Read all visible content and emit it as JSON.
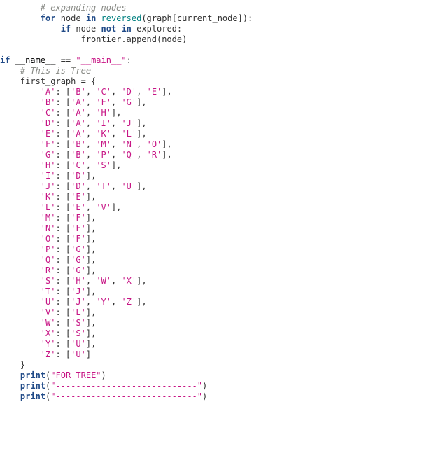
{
  "code": {
    "l1_indent": "        ",
    "l1_comment": "# expanding nodes",
    "l2_indent": "        ",
    "l2_kw_for": "for",
    "l2_var": " node ",
    "l2_kw_in": "in",
    "l2_sp": " ",
    "l2_builtin": "reversed",
    "l2_rest": "(graph[current_node]):",
    "l3_indent": "            ",
    "l3_kw_if": "if",
    "l3_mid": " node ",
    "l3_kw_not": "not",
    "l3_sp": " ",
    "l3_kw_in": "in",
    "l3_rest": " explored:",
    "l4_indent": "                ",
    "l4_rest": "frontier.append(node)",
    "l5_kw_if": "if",
    "l5_sp": " ",
    "l5_name": "__name__",
    "l5_eq": " == ",
    "l5_str": "\"__main__\"",
    "l5_colon": ":",
    "l6_indent": "    ",
    "l6_comment": "# This is Tree",
    "l7_indent": "    ",
    "l7_text": "first_graph = {",
    "graph_indent": "        ",
    "gA_k": "'A'",
    "gA_c": ": [",
    "gA_v1": "'B'",
    "gA_s1": ", ",
    "gA_v2": "'C'",
    "gA_s2": ", ",
    "gA_v3": "'D'",
    "gA_s3": ", ",
    "gA_v4": "'E'",
    "gA_end": "],",
    "gB_k": "'B'",
    "gB_c": ": [",
    "gB_v1": "'A'",
    "gB_s1": ", ",
    "gB_v2": "'F'",
    "gB_s2": ", ",
    "gB_v3": "'G'",
    "gB_end": "],",
    "gC_k": "'C'",
    "gC_c": ": [",
    "gC_v1": "'A'",
    "gC_s1": ", ",
    "gC_v2": "'H'",
    "gC_end": "],",
    "gD_k": "'D'",
    "gD_c": ": [",
    "gD_v1": "'A'",
    "gD_s1": ", ",
    "gD_v2": "'I'",
    "gD_s2": ", ",
    "gD_v3": "'J'",
    "gD_end": "],",
    "gE_k": "'E'",
    "gE_c": ": [",
    "gE_v1": "'A'",
    "gE_s1": ", ",
    "gE_v2": "'K'",
    "gE_s2": ", ",
    "gE_v3": "'L'",
    "gE_end": "],",
    "gF_k": "'F'",
    "gF_c": ": [",
    "gF_v1": "'B'",
    "gF_s1": ", ",
    "gF_v2": "'M'",
    "gF_s2": ", ",
    "gF_v3": "'N'",
    "gF_s3": ", ",
    "gF_v4": "'O'",
    "gF_end": "],",
    "gG_k": "'G'",
    "gG_c": ": [",
    "gG_v1": "'B'",
    "gG_s1": ", ",
    "gG_v2": "'P'",
    "gG_s2": ", ",
    "gG_v3": "'Q'",
    "gG_s3": ", ",
    "gG_v4": "'R'",
    "gG_end": "],",
    "gH_k": "'H'",
    "gH_c": ": [",
    "gH_v1": "'C'",
    "gH_s1": ", ",
    "gH_v2": "'S'",
    "gH_end": "],",
    "gI_k": "'I'",
    "gI_c": ": [",
    "gI_v1": "'D'",
    "gI_end": "],",
    "gJ_k": "'J'",
    "gJ_c": ": [",
    "gJ_v1": "'D'",
    "gJ_s1": ", ",
    "gJ_v2": "'T'",
    "gJ_s2": ", ",
    "gJ_v3": "'U'",
    "gJ_end": "],",
    "gK_k": "'K'",
    "gK_c": ": [",
    "gK_v1": "'E'",
    "gK_end": "],",
    "gL_k": "'L'",
    "gL_c": ": [",
    "gL_v1": "'E'",
    "gL_s1": ", ",
    "gL_v2": "'V'",
    "gL_end": "],",
    "gM_k": "'M'",
    "gM_c": ": [",
    "gM_v1": "'F'",
    "gM_end": "],",
    "gN_k": "'N'",
    "gN_c": ": [",
    "gN_v1": "'F'",
    "gN_end": "],",
    "gO_k": "'O'",
    "gO_c": ": [",
    "gO_v1": "'F'",
    "gO_end": "],",
    "gP_k": "'P'",
    "gP_c": ": [",
    "gP_v1": "'G'",
    "gP_end": "],",
    "gQ_k": "'Q'",
    "gQ_c": ": [",
    "gQ_v1": "'G'",
    "gQ_end": "],",
    "gR_k": "'R'",
    "gR_c": ": [",
    "gR_v1": "'G'",
    "gR_end": "],",
    "gS_k": "'S'",
    "gS_c": ": [",
    "gS_v1": "'H'",
    "gS_s1": ", ",
    "gS_v2": "'W'",
    "gS_s2": ", ",
    "gS_v3": "'X'",
    "gS_end": "],",
    "gT_k": "'T'",
    "gT_c": ": [",
    "gT_v1": "'J'",
    "gT_end": "],",
    "gU_k": "'U'",
    "gU_c": ": [",
    "gU_v1": "'J'",
    "gU_s1": ", ",
    "gU_v2": "'Y'",
    "gU_s2": ", ",
    "gU_v3": "'Z'",
    "gU_end": "],",
    "gV_k": "'V'",
    "gV_c": ": [",
    "gV_v1": "'L'",
    "gV_end": "],",
    "gW_k": "'W'",
    "gW_c": ": [",
    "gW_v1": "'S'",
    "gW_end": "],",
    "gX_k": "'X'",
    "gX_c": ": [",
    "gX_v1": "'S'",
    "gX_end": "],",
    "gY_k": "'Y'",
    "gY_c": ": [",
    "gY_v1": "'U'",
    "gY_end": "],",
    "gZ_k": "'Z'",
    "gZ_c": ": [",
    "gZ_v1": "'U'",
    "gZ_end": "]",
    "close_indent": "    ",
    "close_brace": "}",
    "p1_indent": "    ",
    "p1_fn": "print",
    "p1_open": "(",
    "p1_str": "\"FOR TREE\"",
    "p1_close": ")",
    "p2_indent": "    ",
    "p2_fn": "print",
    "p2_open": "(",
    "p2_str": "\"----------------------------\"",
    "p2_close": ")",
    "p3_indent": "    ",
    "p3_fn": "print",
    "p3_open": "(",
    "p3_str": "\"----------------------------\"",
    "p3_close": ")"
  }
}
